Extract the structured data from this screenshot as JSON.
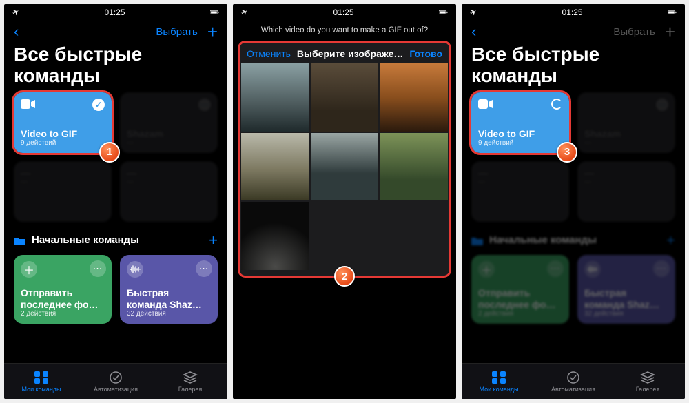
{
  "status": {
    "time": "01:25",
    "airplane": "✈",
    "battery_icon": "battery"
  },
  "nav": {
    "back_icon": "‹",
    "select": "Выбрать",
    "plus": "+"
  },
  "title": "Все быстрые команды",
  "shortcut": {
    "title": "Video to GIF",
    "sub": "9 действий",
    "check": "✓"
  },
  "section": {
    "label": "Начальные команды",
    "plus": "+"
  },
  "starter": {
    "green": {
      "title": "Отправить последнее фо…",
      "sub": "2 действия",
      "icon": "＋"
    },
    "purple": {
      "title": "Быстрая команда Shaz…",
      "sub": "32 действия"
    }
  },
  "tabs": {
    "my": "Мои команды",
    "auto": "Автоматизация",
    "gallery": "Галерея"
  },
  "picker": {
    "question": "Which video do you want to make a GIF out of?",
    "cancel": "Отменить",
    "title": "Выберите изображе…",
    "done": "Готово"
  },
  "steps": {
    "one": "1",
    "two": "2",
    "three": "3"
  }
}
